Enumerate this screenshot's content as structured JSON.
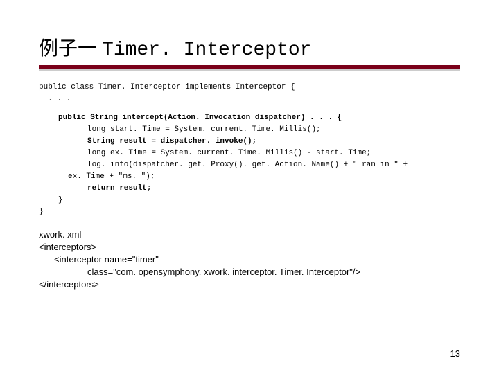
{
  "title_cn": "例子一 ",
  "title_mono": "Timer. Interceptor",
  "code": {
    "line1": "public class Timer. Interceptor implements Interceptor {",
    "line2": "  . . .",
    "line3": "public String intercept(Action. Invocation dispatcher) . . . {",
    "line4": "long start. Time = System. current. Time. Millis();",
    "line5": "String result = dispatcher. invoke();",
    "line6": "long ex. Time = System. current. Time. Millis() - start. Time;",
    "line7": "log. info(dispatcher. get. Proxy(). get. Action. Name() + \" ran in \" +",
    "line8": "ex. Time + \"ms. \");",
    "line9": "return result;",
    "line10": "}",
    "line11": "}"
  },
  "xml": {
    "l1": "xwork. xml",
    "l2": "<interceptors>",
    "l3": "<interceptor name=\"timer\"",
    "l4": "class=\"com. opensymphony. xwork. interceptor. Timer. Interceptor\"/>",
    "l5": "</interceptors>"
  },
  "page_number": "13"
}
